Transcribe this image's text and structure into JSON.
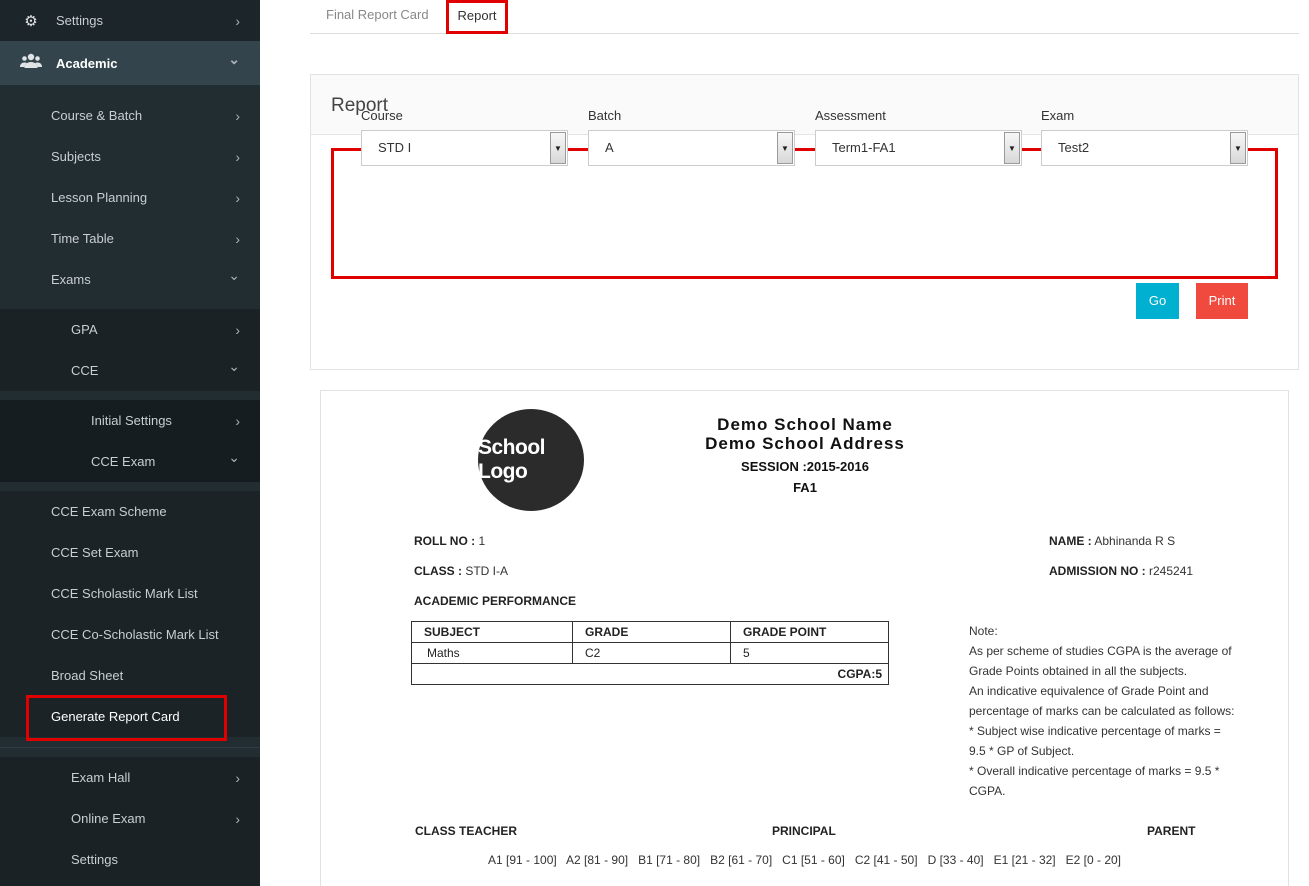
{
  "sidebar": {
    "settings_top": "Settings",
    "academic": "Academic",
    "items": {
      "course_batch": "Course & Batch",
      "subjects": "Subjects",
      "lesson_planning": "Lesson Planning",
      "time_table": "Time Table",
      "exams": "Exams",
      "gpa": "GPA",
      "cce": "CCE",
      "initial_settings": "Initial Settings",
      "cce_exam": "CCE Exam",
      "cce_exam_scheme": "CCE Exam Scheme",
      "cce_set_exam": "CCE Set Exam",
      "cce_scholastic": "CCE Scholastic Mark List",
      "cce_co_scholastic": "CCE Co-Scholastic Mark List",
      "broad_sheet": "Broad Sheet",
      "generate_report_card": "Generate Report Card",
      "exam_hall": "Exam Hall",
      "online_exam": "Online Exam",
      "settings_bottom": "Settings"
    },
    "chevron_right": "›",
    "chevron_down": "⌄",
    "icons": {
      "settings": "gears-icon",
      "academic": "users-icon"
    }
  },
  "tabs": {
    "final_report_card": "Final Report Card",
    "report": "Report"
  },
  "panel": {
    "title": "Report",
    "fields": {
      "course": {
        "label": "Course",
        "value": "STD I"
      },
      "batch": {
        "label": "Batch",
        "value": "A"
      },
      "assessment": {
        "label": "Assessment",
        "value": "Term1-FA1"
      },
      "exam": {
        "label": "Exam",
        "value": "Test2"
      }
    },
    "go_label": "Go",
    "print_label": "Print"
  },
  "card": {
    "logo_text": "School Logo",
    "school_name": "Demo School Name",
    "school_address": "Demo School Address",
    "session": "SESSION :2015-2016",
    "assessment": "FA1",
    "roll_label": "ROLL NO :",
    "roll_value": "1",
    "name_label": "NAME :",
    "name_value": "Abhinanda R S",
    "class_label": "CLASS :",
    "class_value": "STD I-A",
    "admission_label": "ADMISSION NO :",
    "admission_value": "r245241",
    "perf_title": "ACADEMIC PERFORMANCE",
    "table": {
      "headers": [
        "SUBJECT",
        "GRADE",
        "GRADE POINT"
      ],
      "rows": [
        [
          "Maths",
          "C2",
          "5"
        ]
      ],
      "cgpa": "CGPA:5"
    },
    "note": [
      "Note:",
      "As per scheme of studies CGPA is the average of",
      "Grade Points obtained in all the subjects.",
      "An indicative equivalence of Grade Point and",
      "percentage of marks can be calculated as follows:",
      "* Subject wise indicative percentage of marks =",
      "9.5 * GP of Subject.",
      "* Overall indicative percentage of marks = 9.5 *",
      "CGPA."
    ],
    "class_teacher": "CLASS TEACHER",
    "principal": "PRINCIPAL",
    "parent": "PARENT",
    "grade_scale": "A1 [91 - 100]   A2 [81 - 90]   B1 [71 - 80]   B2 [61 - 70]   C1 [51 - 60]   C2 [41 - 50]   D [33 - 40]   E1 [21 - 32]   E2 [0 - 20]"
  },
  "colors": {
    "sidebar_bg": "#222d32",
    "highlight": "#e00000",
    "go": "#00b0d0",
    "print": "#f04a3e"
  }
}
